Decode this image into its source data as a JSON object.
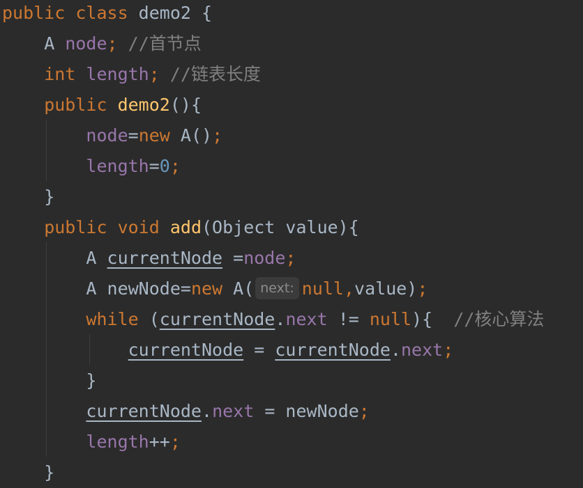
{
  "editor": {
    "lines": [
      {
        "tokens": [
          {
            "t": "public ",
            "c": "kw"
          },
          {
            "t": "class ",
            "c": "kw"
          },
          {
            "t": "demo2 {",
            "c": "plain"
          }
        ]
      },
      {
        "tokens": [
          {
            "t": "    A ",
            "c": "plain"
          },
          {
            "t": "node",
            "c": "fld"
          },
          {
            "t": "; ",
            "c": "kw"
          },
          {
            "t": "//首节点",
            "c": "cmt"
          }
        ]
      },
      {
        "tokens": [
          {
            "t": "    int ",
            "c": "kw"
          },
          {
            "t": "length",
            "c": "fld"
          },
          {
            "t": "; ",
            "c": "kw"
          },
          {
            "t": "//链表长度",
            "c": "cmt"
          }
        ]
      },
      {
        "tokens": [
          {
            "t": "    public ",
            "c": "kw"
          },
          {
            "t": "demo2",
            "c": "fn"
          },
          {
            "t": "(){",
            "c": "plain"
          }
        ]
      },
      {
        "tokens": [
          {
            "t": "        ",
            "c": "plain"
          },
          {
            "t": "node",
            "c": "fld"
          },
          {
            "t": "=",
            "c": "plain"
          },
          {
            "t": "new ",
            "c": "kw"
          },
          {
            "t": "A()",
            "c": "plain"
          },
          {
            "t": ";",
            "c": "kw"
          }
        ]
      },
      {
        "tokens": [
          {
            "t": "        ",
            "c": "plain"
          },
          {
            "t": "length",
            "c": "fld"
          },
          {
            "t": "=",
            "c": "plain"
          },
          {
            "t": "0",
            "c": "num"
          },
          {
            "t": ";",
            "c": "kw"
          }
        ]
      },
      {
        "tokens": [
          {
            "t": "    }",
            "c": "plain"
          }
        ]
      },
      {
        "tokens": [
          {
            "t": "    public ",
            "c": "kw"
          },
          {
            "t": "void ",
            "c": "kw"
          },
          {
            "t": "add",
            "c": "fn"
          },
          {
            "t": "(Object value){",
            "c": "plain"
          }
        ]
      },
      {
        "tokens": [
          {
            "t": "        A ",
            "c": "plain"
          },
          {
            "t": "currentNode",
            "c": "plain ul"
          },
          {
            "t": " =",
            "c": "plain"
          },
          {
            "t": "node",
            "c": "fld"
          },
          {
            "t": ";",
            "c": "kw"
          }
        ]
      },
      {
        "tokens": [
          {
            "t": "        A newNode=",
            "c": "plain"
          },
          {
            "t": "new ",
            "c": "kw"
          },
          {
            "t": "A(",
            "c": "plain"
          },
          {
            "t": "next:",
            "c": "hint"
          },
          {
            "t": "null",
            "c": "kw"
          },
          {
            "t": ",",
            "c": "kw"
          },
          {
            "t": "value)",
            "c": "plain"
          },
          {
            "t": ";",
            "c": "kw"
          }
        ]
      },
      {
        "tokens": [
          {
            "t": "        ",
            "c": "plain"
          },
          {
            "t": "while ",
            "c": "kw"
          },
          {
            "t": "(",
            "c": "plain"
          },
          {
            "t": "currentNode",
            "c": "plain ul"
          },
          {
            "t": ".",
            "c": "plain"
          },
          {
            "t": "next",
            "c": "fld"
          },
          {
            "t": " != ",
            "c": "plain"
          },
          {
            "t": "null",
            "c": "kw"
          },
          {
            "t": "){  ",
            "c": "plain"
          },
          {
            "t": "//核心算法",
            "c": "cmt"
          }
        ]
      },
      {
        "tokens": [
          {
            "t": "            ",
            "c": "plain"
          },
          {
            "t": "currentNode",
            "c": "plain ul"
          },
          {
            "t": " = ",
            "c": "plain"
          },
          {
            "t": "currentNode",
            "c": "plain ul"
          },
          {
            "t": ".",
            "c": "plain"
          },
          {
            "t": "next",
            "c": "fld"
          },
          {
            "t": ";",
            "c": "kw"
          }
        ]
      },
      {
        "tokens": [
          {
            "t": "        }",
            "c": "plain"
          }
        ]
      },
      {
        "tokens": [
          {
            "t": "        ",
            "c": "plain"
          },
          {
            "t": "currentNode",
            "c": "plain ul"
          },
          {
            "t": ".",
            "c": "plain"
          },
          {
            "t": "next",
            "c": "fld"
          },
          {
            "t": " = newNode",
            "c": "plain"
          },
          {
            "t": ";",
            "c": "kw"
          }
        ]
      },
      {
        "tokens": [
          {
            "t": "        ",
            "c": "plain"
          },
          {
            "t": "length",
            "c": "fld"
          },
          {
            "t": "++",
            "c": "plain"
          },
          {
            "t": ";",
            "c": "kw"
          }
        ]
      },
      {
        "tokens": [
          {
            "t": "    }",
            "c": "plain"
          }
        ]
      }
    ]
  }
}
